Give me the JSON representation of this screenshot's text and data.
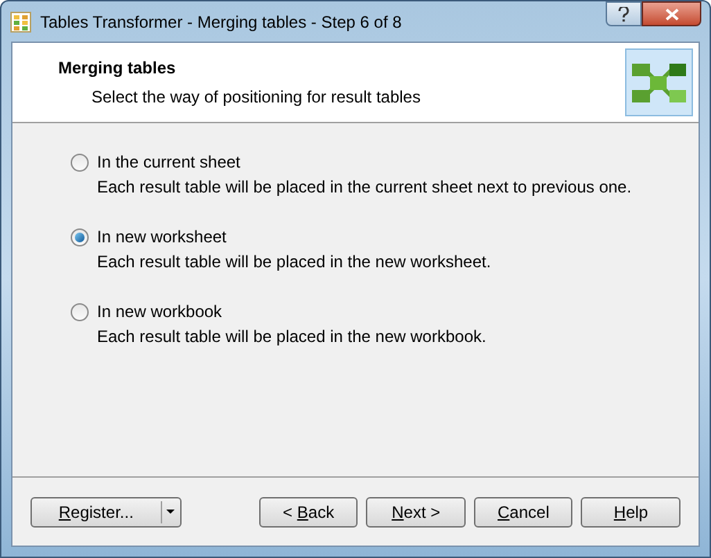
{
  "window": {
    "title": "Tables Transformer - Merging tables - Step 6 of 8"
  },
  "header": {
    "title": "Merging tables",
    "subtitle": "Select the way of positioning for result tables"
  },
  "options": [
    {
      "label": "In the current sheet",
      "description": "Each result table will be placed in the current sheet next to previous one.",
      "selected": false
    },
    {
      "label": "In new worksheet",
      "description": "Each result table will be placed in the new worksheet.",
      "selected": true
    },
    {
      "label": "In new workbook",
      "description": "Each result table will be placed in the new workbook.",
      "selected": false
    }
  ],
  "buttons": [
    {
      "kind": "split",
      "key": "R",
      "post": "egister..."
    },
    {
      "kind": "plain",
      "pre": "< ",
      "key": "B",
      "post": "ack"
    },
    {
      "kind": "plain",
      "key": "N",
      "post": "ext >"
    },
    {
      "kind": "plain",
      "key": "C",
      "post": "ancel"
    },
    {
      "kind": "plain",
      "key": "H",
      "post": "elp"
    }
  ]
}
